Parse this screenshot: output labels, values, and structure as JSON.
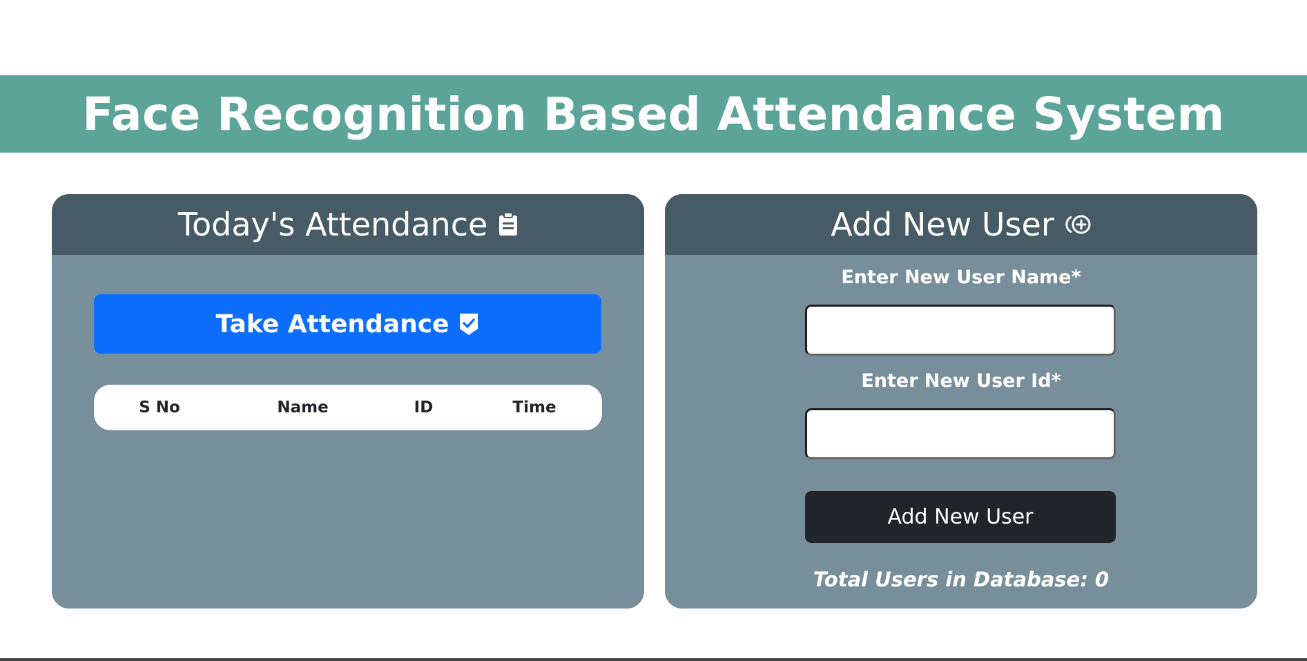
{
  "header": {
    "title": "Face Recognition Based Attendance System"
  },
  "attendance_card": {
    "title": "Today's Attendance",
    "title_icon": "clipboard-icon",
    "take_button_label": "Take Attendance",
    "take_button_icon": "shield-check-icon",
    "table_headers": [
      "S No",
      "Name",
      "ID",
      "Time"
    ],
    "rows": []
  },
  "add_user_card": {
    "title": "Add New User",
    "title_icon": "person-add-icon",
    "name_label": "Enter New User Name*",
    "name_value": "",
    "id_label": "Enter New User Id*",
    "id_value": "",
    "add_button_label": "Add New User",
    "total_users_text": "Total Users in Database: 0"
  },
  "colors": {
    "banner": "#5ca497",
    "card_header": "#475b66",
    "card_body": "#778f9a",
    "primary_button": "#0d6efd",
    "dark_button": "#212529"
  }
}
